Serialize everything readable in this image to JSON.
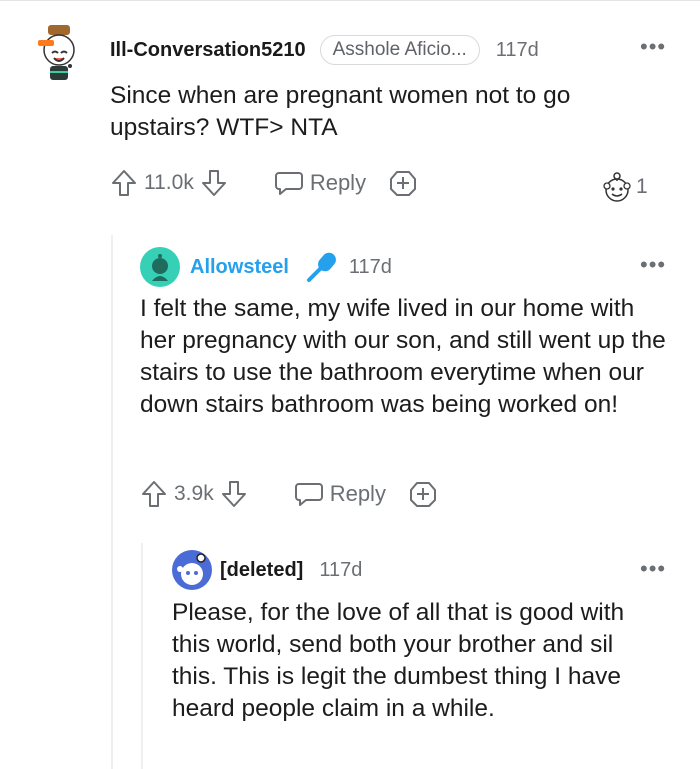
{
  "comments": [
    {
      "username": "Ill-Conversation5210",
      "flair": "Asshole Aficio...",
      "time": "117d",
      "body": "Since when are pregnant women not to go upstairs? WTF> NTA",
      "votes": "11.0k",
      "reply_label": "Reply",
      "award_count": "1",
      "more_icon": "more-dots-icon"
    },
    {
      "username": "Allowsteel",
      "time": "117d",
      "body": "I felt the same, my wife lived in our home with her pregnancy with our son, and still went up the stairs to use the bathroom everytime when our down stairs bathroom was being worked on!",
      "votes": "3.9k",
      "reply_label": "Reply",
      "username_color": "#24a0ed"
    },
    {
      "username": "[deleted]",
      "time": "117d",
      "body": "Please, for the love of all that is good with this world, send both your brother and sil this. This is legit the dumbest thing I have heard people claim in a while."
    }
  ],
  "colors": {
    "icon_gray": "#6b6f73",
    "accent_blue": "#24a0ed",
    "avatar_teal": "#35d0b5",
    "deleted_avatar": "#4b6cd6"
  }
}
